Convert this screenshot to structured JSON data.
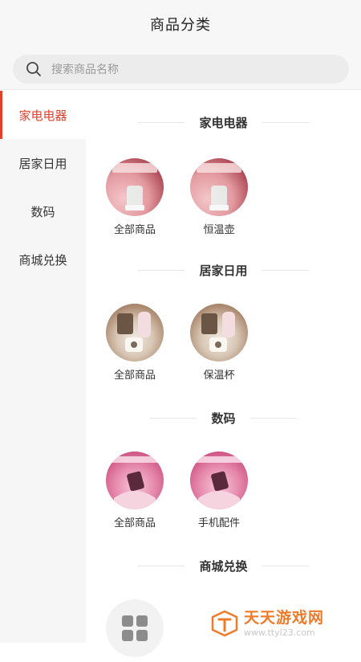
{
  "header": {
    "title": "商品分类"
  },
  "search": {
    "placeholder": "搜索商品名称",
    "icon": "search-icon"
  },
  "sidebar": {
    "items": [
      {
        "label": "家电电器",
        "active": true
      },
      {
        "label": "居家日用",
        "active": false
      },
      {
        "label": "数码",
        "active": false
      },
      {
        "label": "商城兑换",
        "active": false
      }
    ]
  },
  "sections": [
    {
      "title": "家电电器",
      "items": [
        {
          "label": "全部商品"
        },
        {
          "label": "恒温壶"
        }
      ]
    },
    {
      "title": "居家日用",
      "items": [
        {
          "label": "全部商品"
        },
        {
          "label": "保温杯"
        }
      ]
    },
    {
      "title": "数码",
      "items": [
        {
          "label": "全部商品"
        },
        {
          "label": "手机配件"
        }
      ]
    },
    {
      "title": "商城兑换",
      "items": [
        {
          "label": ""
        }
      ]
    }
  ],
  "colors": {
    "accent": "#e2402c",
    "watermark": "#ef7a2a"
  },
  "watermark": {
    "brand": "天天游戏网",
    "url": "www.ttyl23.com"
  }
}
